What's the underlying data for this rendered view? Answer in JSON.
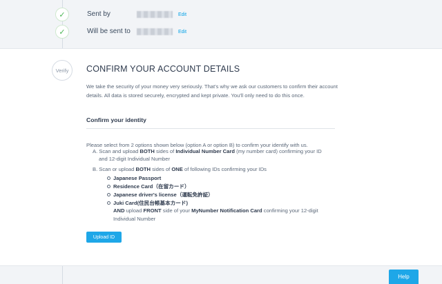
{
  "steps": [
    {
      "label": "Sent by",
      "action": "Edit",
      "status": "done"
    },
    {
      "label": "Will be sent to",
      "action": "Edit",
      "status": "done"
    }
  ],
  "verify": {
    "step_label": "Verify",
    "title": "CONFIRM YOUR ACCOUNT DETAILS",
    "intro": "We take the security of your money very seriously. That's why we ask our customers to confirm their account details. All data is stored securely, encrypted and kept private. You'll only need to do this once.",
    "subtitle": "Confirm your identity",
    "instruction": "Please select from 2 options shown below (option A or option B) to confirm your identify with us.",
    "option_a": {
      "prefix": "A. Scan and upload ",
      "both": "BOTH",
      "mid": " sides of ",
      "doc": "Individual Number Card",
      "suffix": " (my number card) confirming your ID",
      "line2": "and 12-digit Individual Number"
    },
    "option_b": {
      "prefix": "B. Scan or upload ",
      "both": "BOTH",
      "mid": " sides of ",
      "one": "ONE",
      "suffix": " of following IDs confirming your IDs"
    },
    "id_options": [
      "Japanese Passport",
      "Residence Card（在留カード）",
      "Japanese driver's license（運転免許証）",
      "Juki Card(住民台帳基本カード)"
    ],
    "juki_note": {
      "and": "AND",
      "upload": " upload ",
      "front": "FRONT",
      "side_of": " side of your ",
      "mynumber": "MyNumber Notification Card",
      "suffix": " confirming your 12-digit",
      "line2": "Individual Number"
    },
    "upload_button": "Upload ID"
  },
  "help_button": "Help",
  "colors": {
    "accent": "#1ea7e8",
    "check": "#46b450",
    "background": "#f2f4f7"
  },
  "icons": {
    "check": "check-icon"
  }
}
